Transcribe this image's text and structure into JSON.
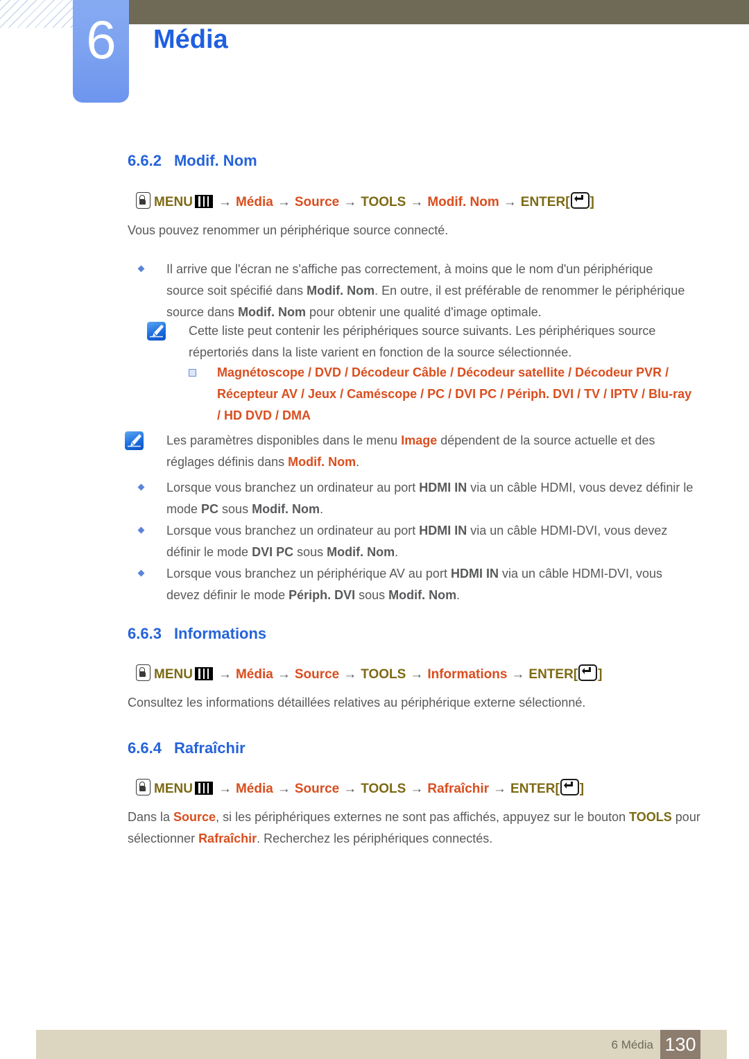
{
  "header": {
    "chapter_number": "6",
    "chapter_title": "Média",
    "accent_blue": "#1f5fe0",
    "badge_blue": "#7fa4f0",
    "bar_olive": "#6e6a55"
  },
  "sections": {
    "s662": {
      "number": "6.6.2",
      "title": "Modif. Nom",
      "menu_path": {
        "menu": "MENU",
        "items": [
          "Média",
          "Source",
          "TOOLS",
          "Modif. Nom"
        ],
        "enter": "ENTER",
        "arrow": "→",
        "bracket_open": "[",
        "bracket_close": "]"
      },
      "intro": "Vous pouvez renommer un périphérique source connecté.",
      "bullet1_a": "Il arrive que l'écran ne s'affiche pas correctement, à moins que le nom d'un périphérique source soit spécifié dans ",
      "bullet1_b": "Modif. Nom",
      "bullet1_c": ". En outre, il est préférable de renommer le périphérique source dans ",
      "bullet1_d": "Modif. Nom",
      "bullet1_e": " pour obtenir une qualité d'image optimale.",
      "note1": "Cette liste peut contenir les périphériques source suivants. Les périphériques source répertoriés dans la liste varient en fonction de la source sélectionnée.",
      "device_list": "Magnétoscope / DVD / Décodeur Câble / Décodeur satellite / Décodeur PVR / Récepteur AV / Jeux / Caméscope / PC / DVI PC / Périph. DVI / TV / IPTV / Blu-ray / HD DVD / DMA",
      "note2_a": "Les paramètres disponibles dans le menu ",
      "note2_b": "Image",
      "note2_c": " dépendent de la source actuelle et des réglages définis dans ",
      "note2_d": "Modif. Nom",
      "note2_e": ".",
      "bullet2_a": "Lorsque vous branchez un ordinateur au port ",
      "bullet2_b": "HDMI IN",
      "bullet2_c": " via un câble HDMI, vous devez définir le mode ",
      "bullet2_d": "PC",
      "bullet2_e": " sous ",
      "bullet2_f": "Modif. Nom",
      "bullet2_g": ".",
      "bullet3_a": "Lorsque vous branchez un ordinateur au port ",
      "bullet3_b": "HDMI IN",
      "bullet3_c": " via un câble HDMI-DVI, vous devez définir le mode ",
      "bullet3_d": "DVI PC",
      "bullet3_e": " sous ",
      "bullet3_f": "Modif. Nom",
      "bullet3_g": ".",
      "bullet4_a": "Lorsque vous branchez un périphérique AV au port ",
      "bullet4_b": "HDMI IN",
      "bullet4_c": " via un câble HDMI-DVI, vous devez définir le mode ",
      "bullet4_d": "Périph. DVI",
      "bullet4_e": " sous ",
      "bullet4_f": "Modif. Nom",
      "bullet4_g": "."
    },
    "s663": {
      "number": "6.6.3",
      "title": "Informations",
      "menu_path": {
        "menu": "MENU",
        "items": [
          "Média",
          "Source",
          "TOOLS",
          "Informations"
        ],
        "enter": "ENTER",
        "arrow": "→",
        "bracket_open": "[",
        "bracket_close": "]"
      },
      "body": "Consultez les informations détaillées relatives au périphérique externe sélectionné."
    },
    "s664": {
      "number": "6.6.4",
      "title": "Rafraîchir",
      "menu_path": {
        "menu": "MENU",
        "items": [
          "Média",
          "Source",
          "TOOLS",
          "Rafraîchir"
        ],
        "enter": "ENTER",
        "arrow": "→",
        "bracket_open": "[",
        "bracket_close": "]"
      },
      "body_a": "Dans la ",
      "body_b": "Source",
      "body_c": ", si les périphériques externes ne sont pas affichés, appuyez sur le bouton ",
      "body_d": "TOOLS",
      "body_e": " pour sélectionner ",
      "body_f": "Rafraîchir",
      "body_g": ". Recherchez les périphériques connectés."
    }
  },
  "footer": {
    "label": "6 Média",
    "page": "130",
    "bar_color": "#dcd5c0",
    "page_box_color": "#8c7d6e"
  },
  "colors": {
    "heading_blue": "#2563d9",
    "term_red": "#d94e1f",
    "term_olive": "#7d6a14",
    "body_gray": "#58595b"
  }
}
